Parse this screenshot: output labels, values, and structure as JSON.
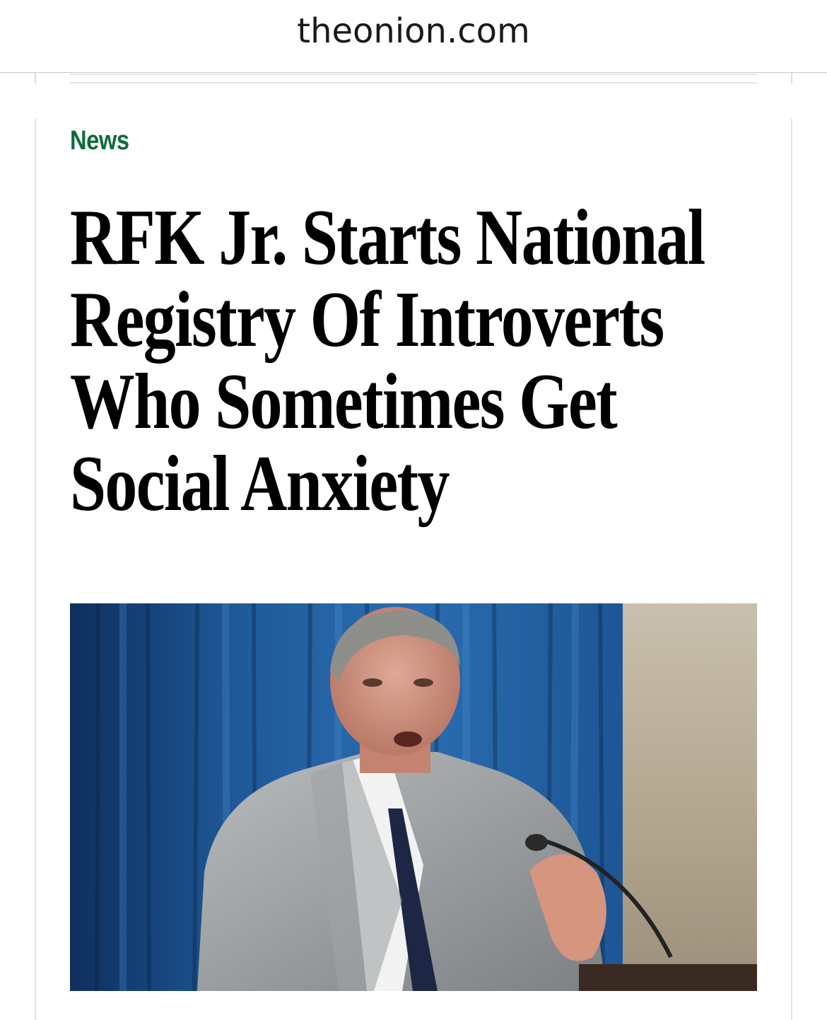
{
  "browser": {
    "url": "theonion.com"
  },
  "article": {
    "category": "News",
    "headline": "RFK Jr. Starts National Registry Of Introverts Who Sometimes Get Social Anxiety",
    "photo_description_icon": "article-photo",
    "accent_color": "#0f6b3a"
  }
}
